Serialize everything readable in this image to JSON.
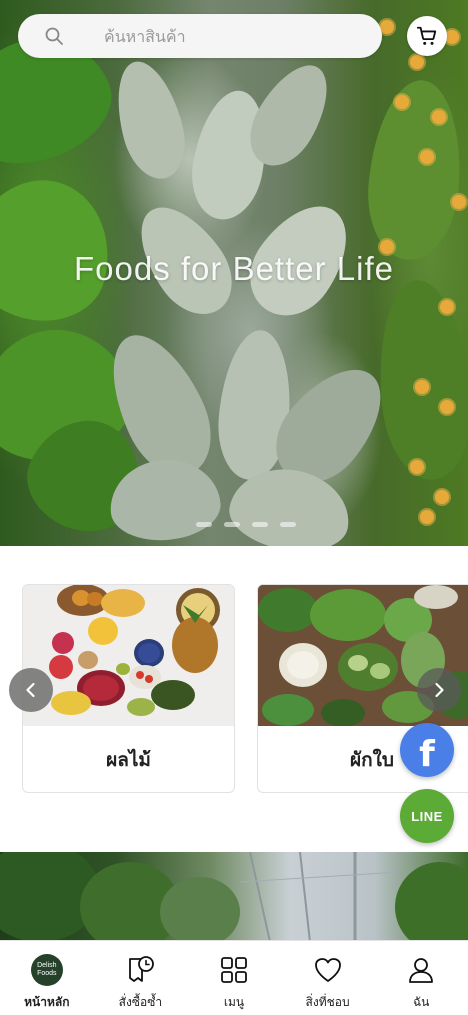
{
  "header": {
    "search": {
      "placeholder": "ค้นหาสินค้า"
    },
    "cart_icon": "cart-icon"
  },
  "hero": {
    "title": "Foods for Better Life",
    "slides": 4
  },
  "categories": [
    {
      "label": "ผลไม้"
    },
    {
      "label": "ผักใบ"
    }
  ],
  "social": {
    "facebook": "f",
    "line": "LINE"
  },
  "bottom_nav": {
    "items": [
      {
        "label": "หน้าหลัก",
        "icon": "brand-logo",
        "active": true
      },
      {
        "label": "สั่งซื้อซ้ำ",
        "icon": "reorder-icon",
        "active": false
      },
      {
        "label": "เมนู",
        "icon": "grid-icon",
        "active": false
      },
      {
        "label": "สิ่งที่ชอบ",
        "icon": "heart-icon",
        "active": false
      },
      {
        "label": "ฉัน",
        "icon": "user-icon",
        "active": false
      }
    ],
    "brand_logo_text": {
      "line1": "Delish",
      "line2": "Foods"
    }
  },
  "colors": {
    "facebook": "#4a7fe8",
    "line": "#5bab36",
    "brand": "#25412a"
  }
}
